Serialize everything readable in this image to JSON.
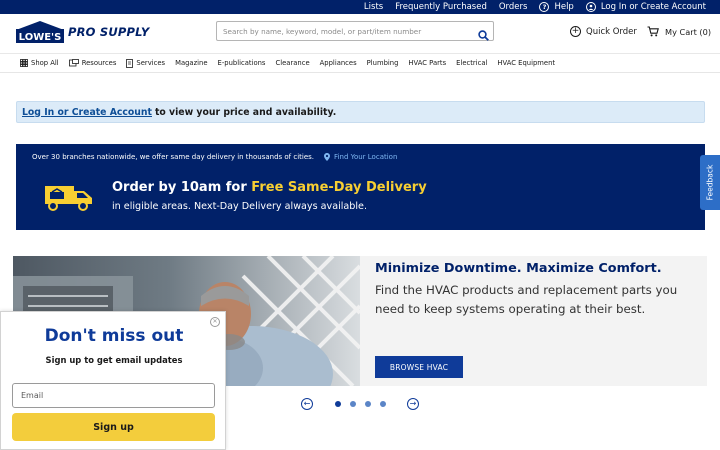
{
  "colors": {
    "brand_navy": "#012169",
    "accent_yellow": "#f8cf32",
    "link_blue": "#0e4e96",
    "button_blue": "#0f3b99",
    "alert_bg": "#dcebf8",
    "signup_yellow": "#f3cd3c"
  },
  "topbar": {
    "lists": "Lists",
    "frequently_purchased": "Frequently Purchased",
    "orders": "Orders",
    "help": "Help",
    "help_icon": "question-circle-icon",
    "login": "Log In or Create Account",
    "login_icon": "user-circle-icon"
  },
  "header": {
    "logo_brand": "LOWE'S",
    "logo_text": "PRO SUPPLY",
    "search_placeholder": "Search by name, keyword, model, or part/item number",
    "search_icon": "search-icon",
    "quick_order": "Quick Order",
    "quick_order_icon": "plus-circle-icon",
    "cart": "My Cart (0)",
    "cart_icon": "cart-icon"
  },
  "nav": {
    "items": [
      {
        "label": "Shop All",
        "icon": "grid-icon"
      },
      {
        "label": "Resources",
        "icon": "resources-icon"
      },
      {
        "label": "Services",
        "icon": "services-icon"
      },
      {
        "label": "Magazine"
      },
      {
        "label": "E-publications"
      },
      {
        "label": "Clearance"
      },
      {
        "label": "Appliances"
      },
      {
        "label": "Plumbing"
      },
      {
        "label": "HVAC Parts"
      },
      {
        "label": "Electrical"
      },
      {
        "label": "HVAC Equipment"
      }
    ]
  },
  "login_bar": {
    "link": "Log In or Create Account",
    "text": "to view your price and availability."
  },
  "promo": {
    "branches": "Over 30 branches nationwide, we offer same day delivery in thousands of cities.",
    "find_location": "Find Your Location",
    "location_icon": "map-pin-icon",
    "truck_icon": "delivery-truck-icon",
    "headline_prefix": "Order by 10am for",
    "headline_highlight": "Free Same-Day Delivery",
    "subline": "in eligible areas. Next-Day Delivery always available."
  },
  "feedback": {
    "label": "Feedback"
  },
  "hero": {
    "title": "Minimize Downtime. Maximize Comfort.",
    "text": "Find the HVAC products and replacement parts you need to keep systems operating at their best.",
    "button": "BROWSE HVAC",
    "slide_count": 4,
    "active_slide": 1
  },
  "popup": {
    "title": "Don't miss out",
    "subtitle": "Sign up to get email updates",
    "email_placeholder": "Email",
    "signup": "Sign up",
    "close_icon": "close-icon"
  }
}
